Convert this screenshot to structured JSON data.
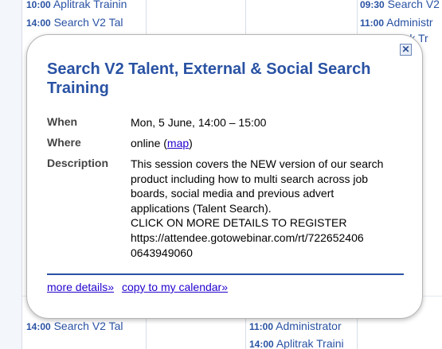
{
  "calendar": {
    "top_left": [
      {
        "time": "10:00",
        "title": "Aplitrak Trainin"
      },
      {
        "time": "14:00",
        "title": "Search V2 Tal"
      }
    ],
    "top_right": [
      {
        "time": "09:30",
        "title": "Search V2"
      },
      {
        "time": "11:00",
        "title": "Administr"
      },
      {
        "time": "",
        "title": "trak Tr"
      }
    ],
    "bottom_left": [
      {
        "time": "",
        "title": ""
      },
      {
        "time": "14:00",
        "title": "Search V2 Tal"
      }
    ],
    "bottom_mid": [
      {
        "time": "11:00",
        "title": "Administrator"
      },
      {
        "time": "14:00",
        "title": "Aplitrak Traini"
      }
    ]
  },
  "popup": {
    "close_symbol": "✕",
    "title": "Search V2 Talent, External & Social Search Training",
    "when_label": "When",
    "when_value": "Mon, 5 June, 14:00 – 15:00",
    "where_label": "Where",
    "where_value": "online (",
    "where_link": "map",
    "where_suffix": ")",
    "description_label": "Description",
    "description_lines": [
      "This session covers the NEW version of our search",
      "product including how to multi search across job",
      "boards, social media and previous advert",
      "applications (Talent Search).",
      "CLICK ON MORE DETAILS TO REGISTER",
      "https://attendee.gotowebinar.com/rt/722652406",
      "0643949060"
    ],
    "more_details_link": "more details»",
    "copy_link": "copy to my calendar»"
  },
  "colors": {
    "accent": "#2952a3",
    "link": "#2200cc"
  }
}
